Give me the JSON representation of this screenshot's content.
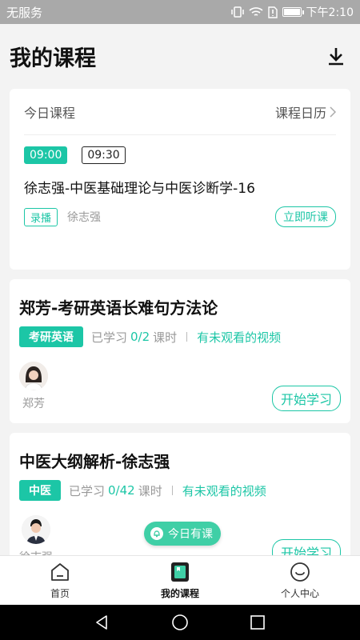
{
  "status_bar": {
    "carrier": "无服务",
    "time": "下午2:10"
  },
  "header": {
    "title": "我的课程"
  },
  "today": {
    "label": "今日课程",
    "calendar_link": "课程日历",
    "start_time": "09:00",
    "end_time": "09:30",
    "lesson_title": "徐志强-中医基础理论与中医诊断学-16",
    "type_tag": "录播",
    "teacher": "徐志强",
    "listen_label": "立即听课"
  },
  "courses": [
    {
      "title": "郑芳-考研英语长难句方法论",
      "tag": "考研英语",
      "studied_prefix": "已学习",
      "progress": "0/2",
      "unit": "课时",
      "unwatched": "有未观看的视频",
      "teacher": "郑芳",
      "start_label": "开始学习"
    },
    {
      "title": "中医大纲解析-徐志强",
      "tag": "中医",
      "studied_prefix": "已学习",
      "progress": "0/42",
      "unit": "课时",
      "unwatched": "有未观看的视频",
      "teacher": "徐志强",
      "start_label": "开始学习"
    }
  ],
  "floating_bubble": {
    "label": "今日有课"
  },
  "tabs": [
    {
      "label": "首页",
      "icon": "home-icon"
    },
    {
      "label": "我的课程",
      "icon": "course-book-icon"
    },
    {
      "label": "个人中心",
      "icon": "smile-face-icon"
    }
  ],
  "colors": {
    "accent": "#1cc6a6",
    "background": "#f3f3f3"
  }
}
